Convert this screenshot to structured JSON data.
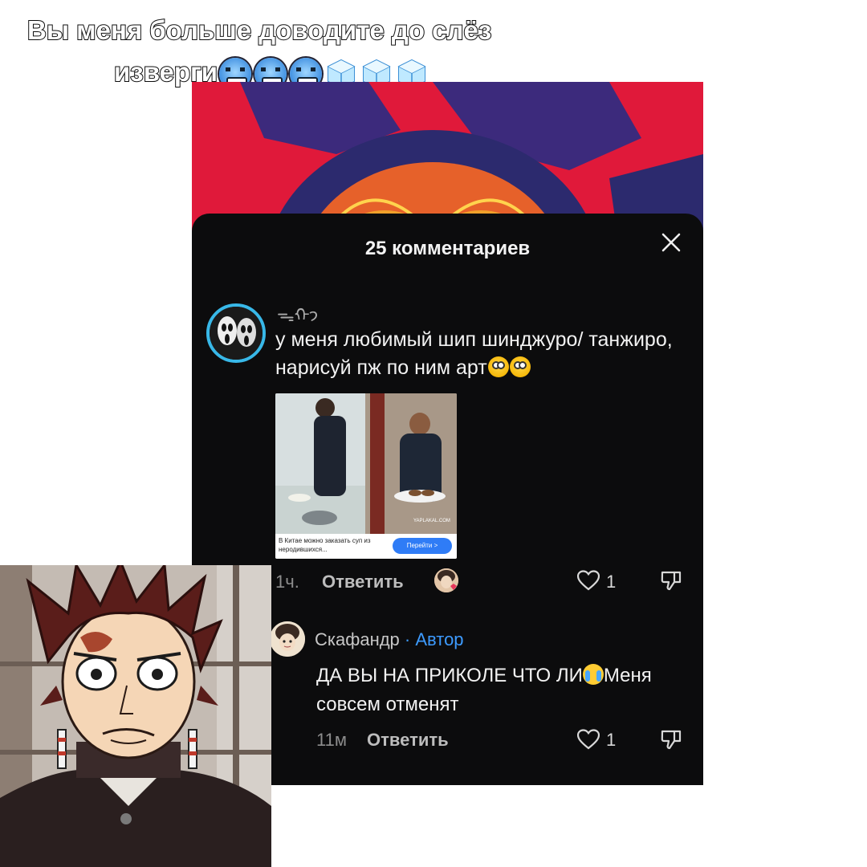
{
  "caption": {
    "line1": "Вы меня больше доводите до слёз",
    "line2": "изверги",
    "emoji_icons": [
      "cold-face-icon",
      "cold-face-icon",
      "cold-face-icon",
      "ice-cube-icon",
      "ice-cube-icon",
      "ice-cube-icon"
    ]
  },
  "panel": {
    "title": "25 комментариев",
    "close_icon": "close-icon"
  },
  "comment1": {
    "username": "ᯓᡣ𐭩",
    "text": "у меня любимый шип шинджуро/ танжиро, нарисуй пж по ним арт",
    "emoji": [
      "flushed-face-icon",
      "flushed-face-icon"
    ],
    "ad": {
      "text": "В Китае можно заказать суп из неродившихся...",
      "button": "Перейти >",
      "watermark": "YAPLAKAL.COM"
    },
    "time": "1ч.",
    "reply": "Ответить",
    "likes": "1"
  },
  "comment2": {
    "username": "Скафандр",
    "author_badge": "· Автор",
    "text_part1": "ДА ВЫ НА ПРИКОЛЕ ЧТО ЛИ",
    "text_part2": "Меня совсем отменят",
    "time": "11м",
    "reply": "Ответить",
    "likes": "1"
  },
  "colors": {
    "panel_bg": "#0c0c0d",
    "author_blue": "#3d9bff",
    "avatar_ring": "#38b8e8",
    "art_red": "#e0193a"
  }
}
